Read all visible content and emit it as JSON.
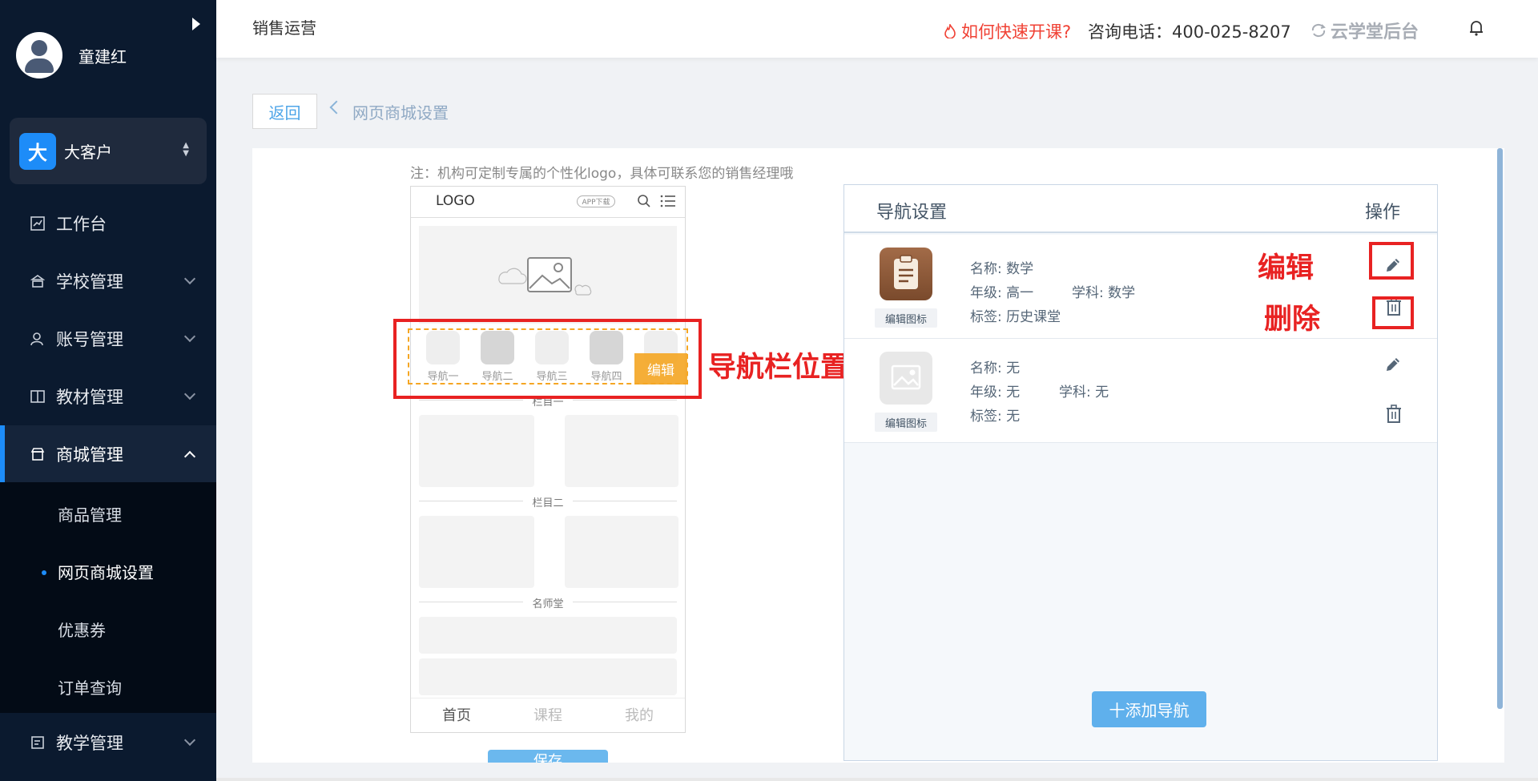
{
  "sidebar": {
    "user_name": "童建红",
    "org_badge": "大",
    "org_name": "大客户",
    "menu": [
      {
        "label": "工作台",
        "icon": "chart-icon"
      },
      {
        "label": "学校管理",
        "icon": "school-icon"
      },
      {
        "label": "账号管理",
        "icon": "user-icon"
      },
      {
        "label": "教材管理",
        "icon": "book-icon"
      },
      {
        "label": "商城管理",
        "icon": "shop-icon"
      },
      {
        "label": "教学管理",
        "icon": "calendar-icon"
      }
    ],
    "submenu": [
      {
        "label": "商品管理"
      },
      {
        "label": "网页商城设置"
      },
      {
        "label": "优惠券"
      },
      {
        "label": "订单查询"
      }
    ]
  },
  "topbar": {
    "title": "销售运营",
    "fast_course": "如何快速开课?",
    "phone": "咨询电话：400-025-8207",
    "brand": "云学堂后台"
  },
  "breadcrumb": {
    "back": "返回",
    "current": "网页商城设置"
  },
  "note": "注：机构可定制专属的个性化logo，具体可联系您的销售经理哦",
  "preview": {
    "logo": "LOGO",
    "app_badge": "APP下载",
    "navs": [
      "导航一",
      "导航二",
      "导航三",
      "导航四"
    ],
    "edit": "编辑",
    "sections": [
      "栏目一",
      "栏目二",
      "名师堂"
    ],
    "tabs": [
      "首页",
      "课程",
      "我的"
    ],
    "save": "保存"
  },
  "annotations": {
    "nav_position": "导航栏位置",
    "edit": "编辑",
    "delete": "删除"
  },
  "nav_settings": {
    "title": "导航设置",
    "op": "操作",
    "rows": [
      {
        "name": "名称: 数学",
        "grade": "年级: 高一",
        "subject": "学科: 数学",
        "tag": "标签: 历史课堂",
        "icon_btn": "编辑图标"
      },
      {
        "name": "名称: 无",
        "grade": "年级: 无",
        "subject": "学科: 无",
        "tag": "标签: 无",
        "icon_btn": "编辑图标"
      }
    ],
    "add": "十添加导航"
  },
  "colors": {
    "sidebar_bg": "#0b1a2f",
    "accent": "#1d8cf8",
    "annotation_red": "#e82222",
    "edit_orange": "#f5a623"
  }
}
